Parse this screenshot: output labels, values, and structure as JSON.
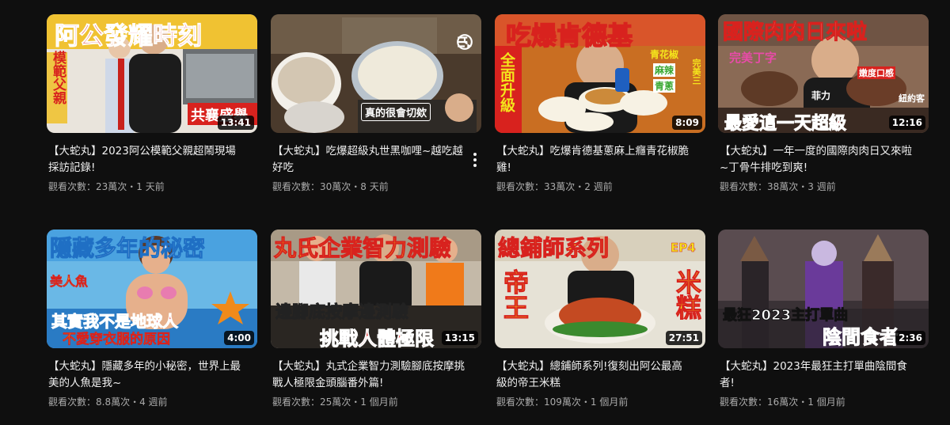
{
  "videos": [
    {
      "title": "【大蛇丸】2023阿公模範父親超鬧現場採訪記錄!",
      "meta": "觀看次數：23萬次・1 天前",
      "duration": "13:41",
      "thumb_text": [
        "阿公發耀時刻",
        "模範父親",
        "共襄盛舉"
      ],
      "colors": {
        "bg": "#e9e4dc",
        "banner": "#f0c232",
        "accent": "#d8221e"
      }
    },
    {
      "title": "【大蛇丸】吃爆超級丸世黑咖哩~越吃越好吃",
      "meta": "觀看次數：30萬次・8 天前",
      "duration": "",
      "thumb_text": [
        "真的很會切欸"
      ],
      "colors": {
        "bg": "#5a4a3a",
        "banner": "#ffffff",
        "accent": "#e6e0c8"
      }
    },
    {
      "title": "【大蛇丸】吃爆肯德基蔥麻上癮青花椒脆雞!",
      "meta": "觀看次數：33萬次・2 週前",
      "duration": "8:09",
      "thumb_text": [
        "吃爆肯德基",
        "全面升級",
        "青花椒",
        "麻辣",
        "青蔥",
        "完美三"
      ],
      "colors": {
        "bg": "#c96e22",
        "banner": "#f4e41c",
        "accent": "#d8221e"
      }
    },
    {
      "title": "【大蛇丸】一年一度的國際肉肉日又來啦~丁骨牛排吃到爽!",
      "meta": "觀看次數：38萬次・3 週前",
      "duration": "12:16",
      "thumb_text": [
        "國際肉肉日來啦",
        "完美丁字",
        "菲力",
        "紐約客",
        "最愛這一天超級",
        "嫩度口感"
      ],
      "colors": {
        "bg": "#8a6a55",
        "banner": "#ffffff",
        "accent": "#d8221e"
      }
    },
    {
      "title": "【大蛇丸】隱藏多年的小秘密，世界上最美的人魚是我~",
      "meta": "觀看次數：8.8萬次・4 週前",
      "duration": "4:00",
      "thumb_text": [
        "隱藏多年的秘密",
        "美人魚",
        "其實我不是地球人",
        "不愛穿衣服的原因"
      ],
      "colors": {
        "bg": "#6ab8e6",
        "banner": "#ffffff",
        "accent": "#e8357a"
      }
    },
    {
      "title": "【大蛇丸】丸式企業智力測驗腳底按摩挑戰人極限金頭腦番外篇!",
      "meta": "觀看次數：25萬次・1 個月前",
      "duration": "13:15",
      "thumb_text": [
        "丸氏企業智力測驗",
        "邊腳底按摩邊測驗",
        "挑戰人體極限"
      ],
      "colors": {
        "bg": "#c4b9a8",
        "banner": "#f4e41c",
        "accent": "#d8221e"
      }
    },
    {
      "title": "【大蛇丸】總鋪師系列!復刻出阿公最高級的帝王米糕",
      "meta": "觀看次數：109萬次・1 個月前",
      "duration": "27:51",
      "thumb_text": [
        "總鋪師系列",
        "EP4",
        "帝王",
        "米糕"
      ],
      "colors": {
        "bg": "#e6e2d6",
        "banner": "#f4e41c",
        "accent": "#d8221e"
      }
    },
    {
      "title": "【大蛇丸】2023年最狂主打單曲陰間食者!",
      "meta": "觀看次數：16萬次・1 個月前",
      "duration": "2:36",
      "thumb_text": [
        "最狂2023主打單曲",
        "陰間食者"
      ],
      "colors": {
        "bg": "#3a3236",
        "banner": "#ffffff",
        "accent": "#d8221e"
      }
    }
  ]
}
